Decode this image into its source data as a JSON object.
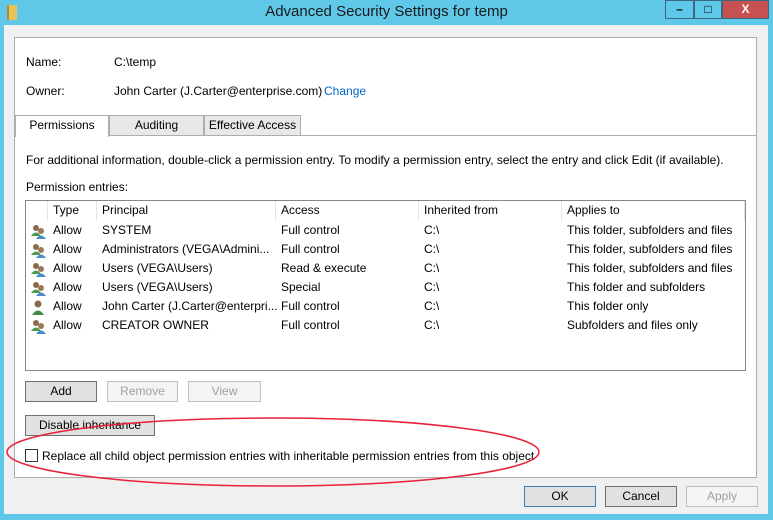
{
  "window": {
    "title": "Advanced Security Settings for temp",
    "minimize": "–",
    "maximize": "□",
    "close": "X"
  },
  "info": {
    "name_label": "Name:",
    "name_value": "C:\\temp",
    "owner_label": "Owner:",
    "owner_value": "John Carter (J.Carter@enterprise.com)",
    "change_link": "Change"
  },
  "tabs": [
    "Permissions",
    "Auditing",
    "Effective Access"
  ],
  "instructions": "For additional information, double-click a permission entry. To modify a permission entry, select the entry and click Edit (if available).",
  "entries_label": "Permission entries:",
  "columns": [
    "Type",
    "Principal",
    "Access",
    "Inherited from",
    "Applies to"
  ],
  "rows": [
    {
      "icon": "group",
      "type": "Allow",
      "principal": "SYSTEM",
      "access": "Full control",
      "inherited": "C:\\",
      "applies": "This folder, subfolders and files"
    },
    {
      "icon": "group",
      "type": "Allow",
      "principal": "Administrators (VEGA\\Admini...",
      "access": "Full control",
      "inherited": "C:\\",
      "applies": "This folder, subfolders and files"
    },
    {
      "icon": "group",
      "type": "Allow",
      "principal": "Users (VEGA\\Users)",
      "access": "Read & execute",
      "inherited": "C:\\",
      "applies": "This folder, subfolders and files"
    },
    {
      "icon": "group",
      "type": "Allow",
      "principal": "Users (VEGA\\Users)",
      "access": "Special",
      "inherited": "C:\\",
      "applies": "This folder and subfolders"
    },
    {
      "icon": "user",
      "type": "Allow",
      "principal": "John Carter (J.Carter@enterpri...",
      "access": "Full control",
      "inherited": "C:\\",
      "applies": "This folder only"
    },
    {
      "icon": "group",
      "type": "Allow",
      "principal": "CREATOR OWNER",
      "access": "Full control",
      "inherited": "C:\\",
      "applies": "Subfolders and files only"
    }
  ],
  "buttons": {
    "add": "Add",
    "remove": "Remove",
    "view": "View",
    "disable_inheritance": "Disable inheritance",
    "ok": "OK",
    "cancel": "Cancel",
    "apply": "Apply"
  },
  "replace_checkbox": {
    "label": "Replace all child object permission entries with inheritable permission entries from this object",
    "checked": false
  },
  "colors": {
    "titlebar": "#5fc8e8",
    "close": "#c75050",
    "annotation": "#e8203c",
    "link": "#0066cc"
  }
}
